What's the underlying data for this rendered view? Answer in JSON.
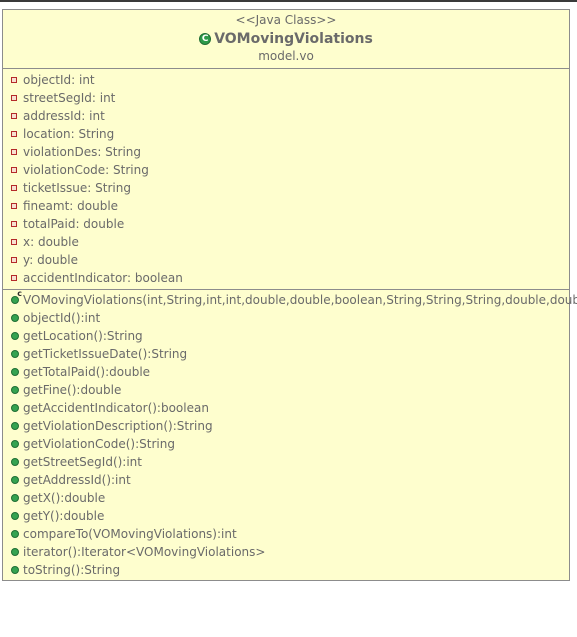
{
  "class": {
    "stereotype": "<<Java Class>>",
    "name": "VOMovingViolations",
    "package": "model.vo",
    "icon_letter": "C",
    "icon": "class-c-icon",
    "colors": {
      "background": "#fefece",
      "border": "#8c8c8c",
      "text": "#6a6a6a",
      "public_icon": "#35a350",
      "private_icon": "#b42a2a"
    }
  },
  "fields": [
    "objectId: int",
    "streetSegId: int",
    "addressId: int",
    "location: String",
    "violationDes: String",
    "violationCode: String",
    "ticketIssue: String",
    "fineamt: double",
    "totalPaid: double",
    "x: double",
    "y: double",
    "accidentIndicator: boolean"
  ],
  "constructor": "VOMovingViolations(int,String,int,int,double,double,boolean,String,String,String,double,double)",
  "methods": [
    "objectId():int",
    "getLocation():String",
    "getTicketIssueDate():String",
    "getTotalPaid():double",
    "getFine():double",
    "getAccidentIndicator():boolean",
    "getViolationDescription():String",
    "getViolationCode():String",
    "getStreetSegId():int",
    "getAddressId():int",
    "getX():double",
    "getY():double",
    "compareTo(VOMovingViolations):int",
    "iterator():Iterator<VOMovingViolations>",
    "toString():String"
  ]
}
